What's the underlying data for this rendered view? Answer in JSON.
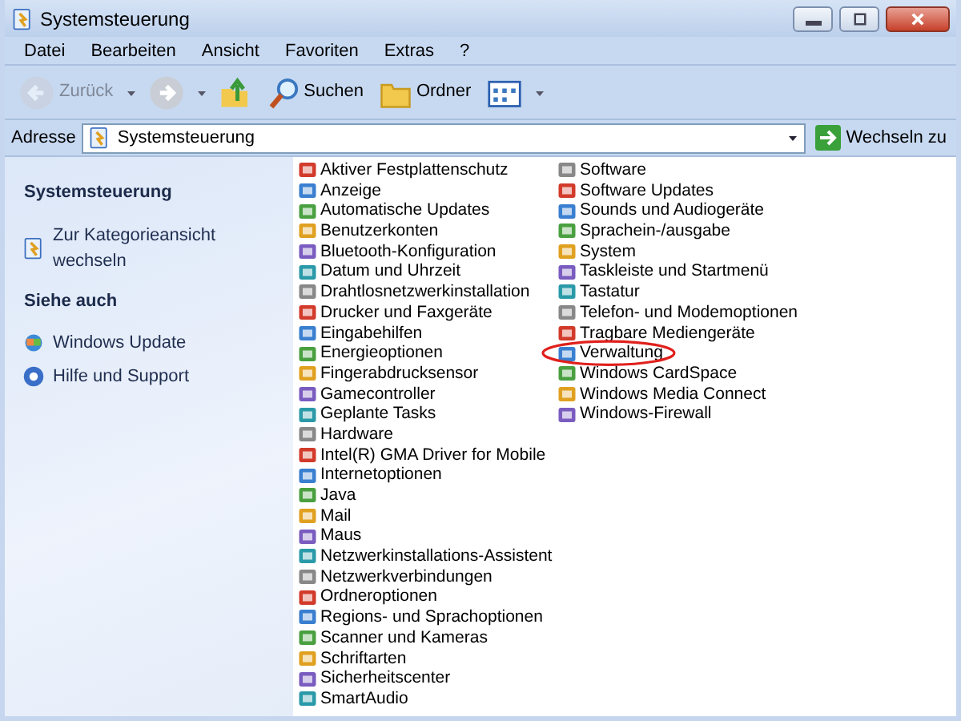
{
  "window": {
    "title": "Systemsteuerung"
  },
  "menu": [
    "Datei",
    "Bearbeiten",
    "Ansicht",
    "Favoriten",
    "Extras",
    "?"
  ],
  "toolbar": [
    {
      "kind": "back",
      "label": "Zurück",
      "disabled": true
    },
    {
      "kind": "forward",
      "disabled": false
    },
    {
      "kind": "up",
      "disabled": false
    },
    {
      "kind": "search",
      "label": "Suchen",
      "disabled": false
    },
    {
      "kind": "folders",
      "label": "Ordner",
      "disabled": false
    },
    {
      "kind": "views",
      "disabled": false
    }
  ],
  "address": {
    "label": "Adresse",
    "value": "Systemsteuerung",
    "go": "Wechseln zu"
  },
  "sidebar": [
    {
      "title": "Systemsteuerung",
      "items": [
        {
          "label": "Zur Kategorieansicht wechseln"
        }
      ]
    },
    {
      "title": "Siehe auch",
      "items": [
        {
          "label": "Windows Update"
        },
        {
          "label": "Hilfe und Support"
        }
      ]
    }
  ],
  "applets": [
    [
      {
        "label": "Aktiver Festplattenschutz",
        "highlighted": false
      },
      {
        "label": "Anzeige",
        "highlighted": false
      },
      {
        "label": "Automatische Updates",
        "highlighted": false
      },
      {
        "label": "Benutzerkonten",
        "highlighted": false
      },
      {
        "label": "Bluetooth-Konfiguration",
        "highlighted": false
      },
      {
        "label": "Datum und Uhrzeit",
        "highlighted": false
      },
      {
        "label": "Drahtlosnetzwerkinstallation",
        "highlighted": false
      },
      {
        "label": "Drucker und Faxgeräte",
        "highlighted": false
      },
      {
        "label": "Eingabehilfen",
        "highlighted": false
      },
      {
        "label": "Energieoptionen",
        "highlighted": false
      },
      {
        "label": "Fingerabdrucksensor",
        "highlighted": false
      },
      {
        "label": "Gamecontroller",
        "highlighted": false
      },
      {
        "label": "Geplante Tasks",
        "highlighted": false
      },
      {
        "label": "Hardware",
        "highlighted": false
      },
      {
        "label": "Intel(R) GMA Driver for Mobile",
        "highlighted": false
      },
      {
        "label": "Internetoptionen",
        "highlighted": false
      },
      {
        "label": "Java",
        "highlighted": false
      },
      {
        "label": "Mail",
        "highlighted": false
      },
      {
        "label": "Maus",
        "highlighted": false
      },
      {
        "label": "Netzwerkinstallations-Assistent",
        "highlighted": false
      },
      {
        "label": "Netzwerkverbindungen",
        "highlighted": false
      },
      {
        "label": "Ordneroptionen",
        "highlighted": false
      },
      {
        "label": "Regions- und Sprachoptionen",
        "highlighted": false
      },
      {
        "label": "Scanner und Kameras",
        "highlighted": false
      },
      {
        "label": "Schriftarten",
        "highlighted": false
      },
      {
        "label": "Sicherheitscenter",
        "highlighted": false
      },
      {
        "label": "SmartAudio",
        "highlighted": false
      }
    ],
    [
      {
        "label": "Software",
        "highlighted": false
      },
      {
        "label": "Software Updates",
        "highlighted": false
      },
      {
        "label": "Sounds und Audiogeräte",
        "highlighted": false
      },
      {
        "label": "Sprachein-/ausgabe",
        "highlighted": false
      },
      {
        "label": "System",
        "highlighted": false
      },
      {
        "label": "Taskleiste und Startmenü",
        "highlighted": false
      },
      {
        "label": "Tastatur",
        "highlighted": false
      },
      {
        "label": "Telefon- und Modemoptionen",
        "highlighted": false
      },
      {
        "label": "Tragbare Mediengeräte",
        "highlighted": false
      },
      {
        "label": "Verwaltung",
        "highlighted": true
      },
      {
        "label": "Windows CardSpace",
        "highlighted": false
      },
      {
        "label": "Windows Media Connect",
        "highlighted": false
      },
      {
        "label": "Windows-Firewall",
        "highlighted": false
      }
    ]
  ]
}
